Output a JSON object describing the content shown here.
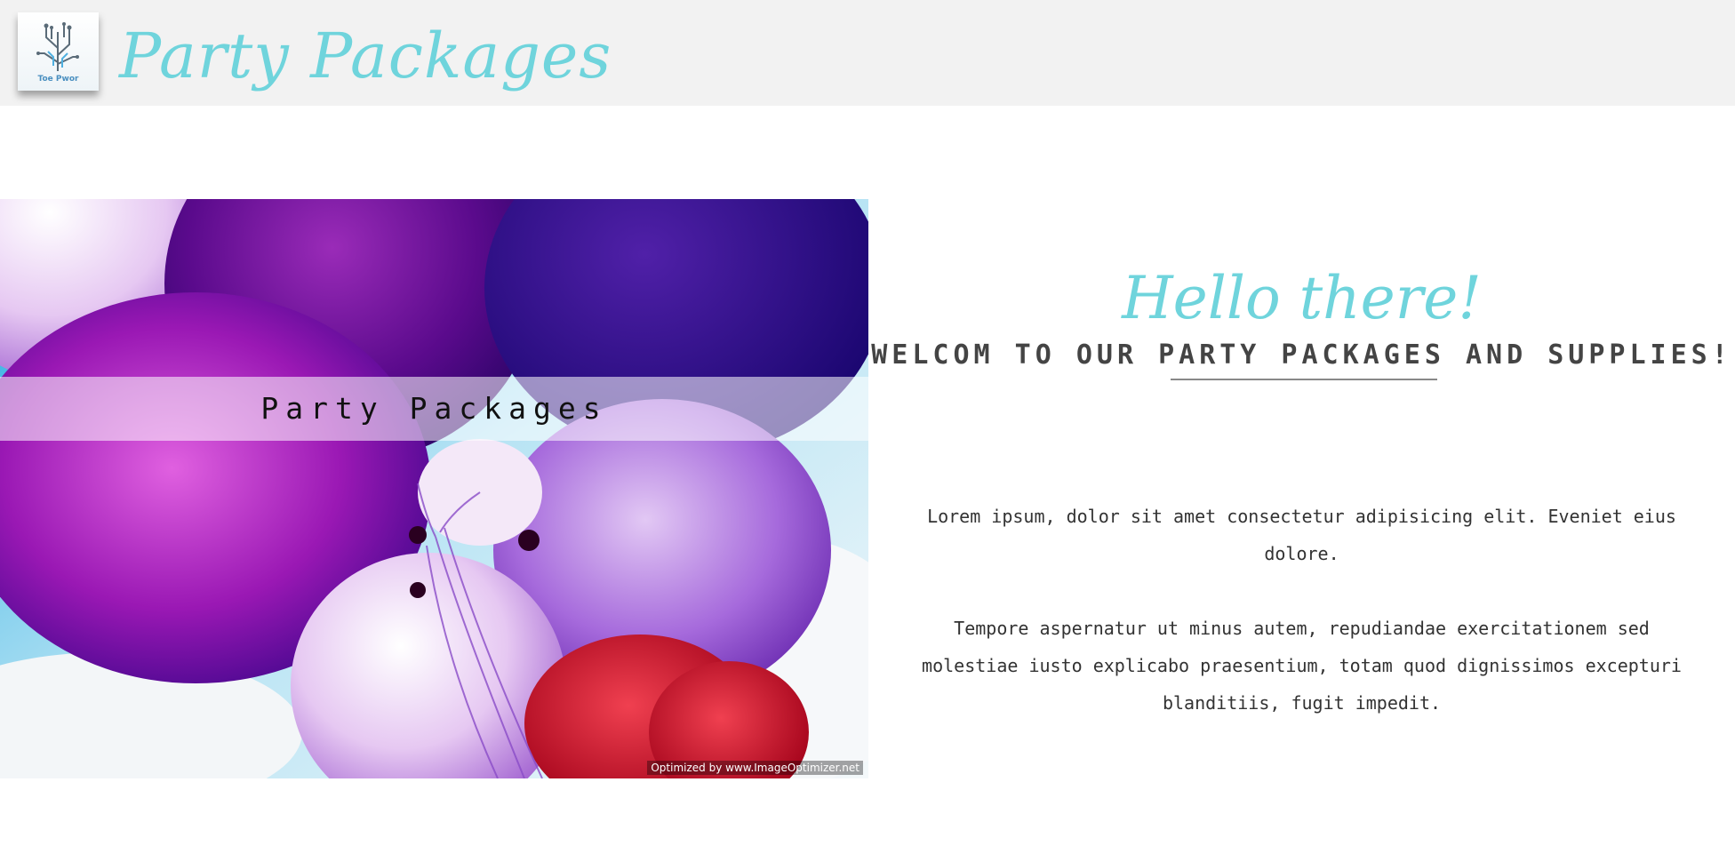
{
  "header": {
    "logo_text": "Toe Pwor",
    "title": "Party Packages"
  },
  "hero": {
    "band_label": "Party Packages",
    "watermark": "Optimized by www.ImageOptimizer.net"
  },
  "content": {
    "greeting": "Hello there!",
    "welcome": "WELCOM TO OUR PARTY PACKAGES AND SUPPLIES!",
    "paragraphs": [
      "Lorem ipsum, dolor sit amet consectetur adipisicing elit. Eveniet eius dolore.",
      "Tempore aspernatur ut minus autem, repudiandae exercitationem sed molestiae iusto explicabo praesentium, totam quod dignissimos excepturi blanditiis, fugit impedit."
    ]
  },
  "colors": {
    "accent": "#6fd4dc",
    "header_bg": "#f2f2f2",
    "text": "#333333"
  },
  "icons": {
    "logo": "circuit-tree-logo-icon"
  }
}
